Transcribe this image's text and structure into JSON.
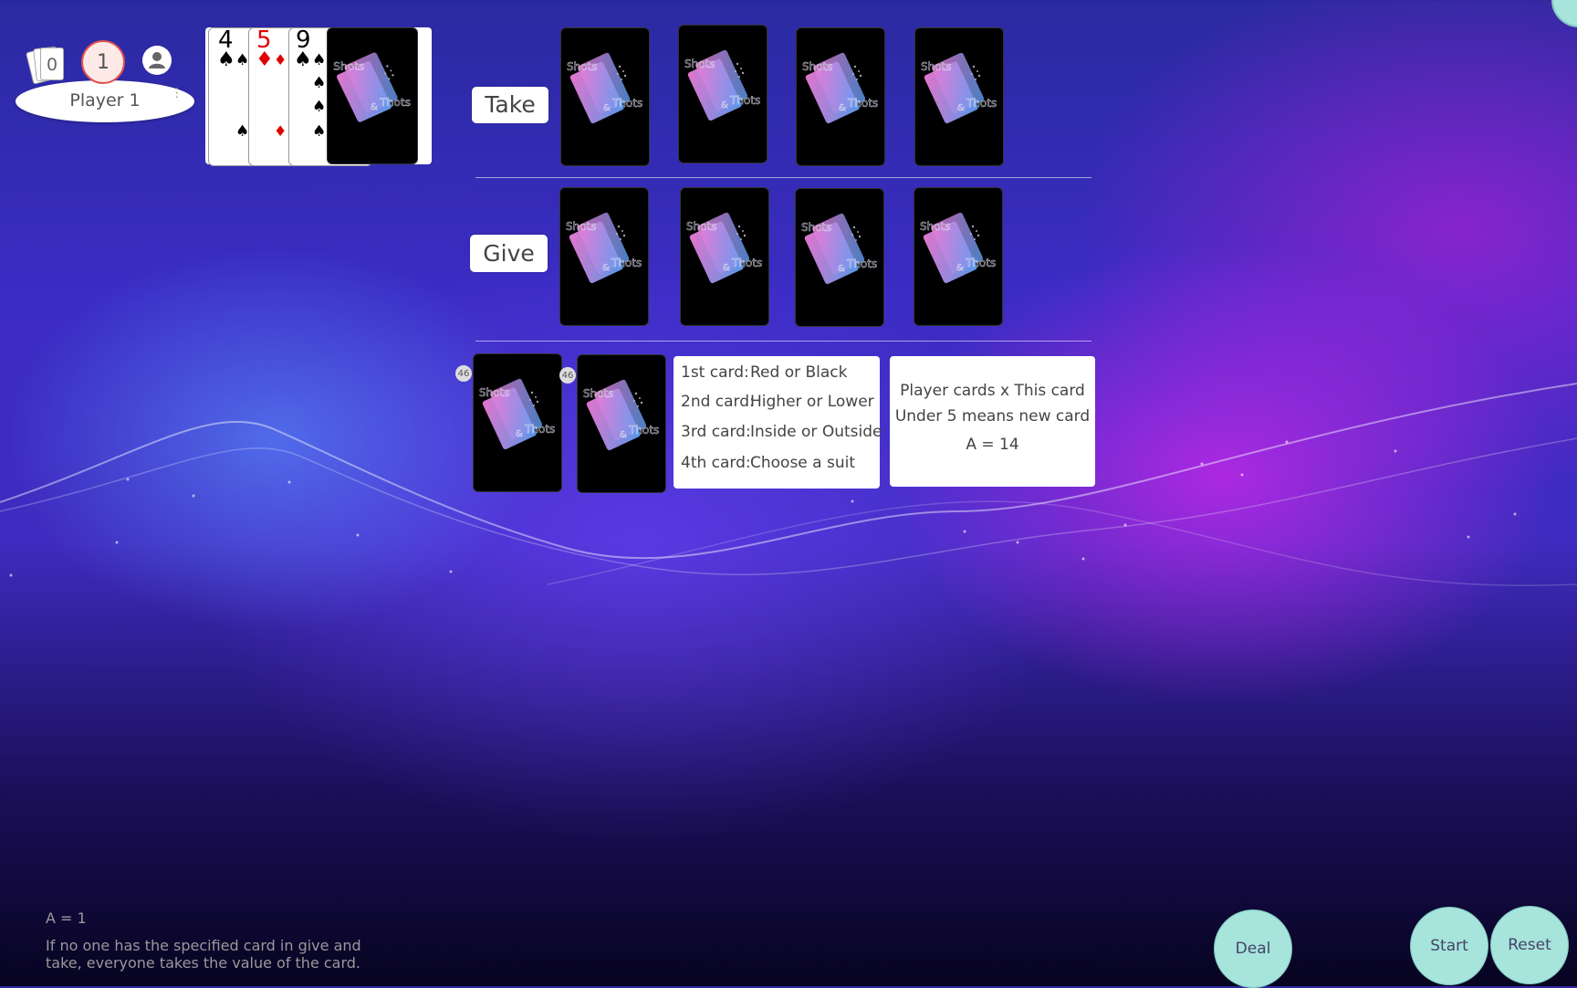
{
  "player": {
    "name": "Player 1",
    "card_count": "0",
    "score": "1"
  },
  "hand": [
    {
      "rank": "4",
      "suit": "♠",
      "color": "#000000"
    },
    {
      "rank": "5",
      "suit": "♦",
      "color": "#e00000"
    },
    {
      "rank": "9",
      "suit": "♠",
      "color": "#000000"
    }
  ],
  "rows": {
    "take_label": "Take",
    "give_label": "Give"
  },
  "card_back": {
    "line1": "Shots",
    "line2": "&",
    "line3": "Thots"
  },
  "deck": {
    "count_left": "46",
    "count_right": "46"
  },
  "rules": [
    {
      "label": "1st card:",
      "value": "Red or Black"
    },
    {
      "label": "2nd card:",
      "value": "Higher or Lower"
    },
    {
      "label": "3rd card:",
      "value": "Inside or Outside"
    },
    {
      "label": "4th card:",
      "value": "Choose a suit"
    }
  ],
  "scoring": {
    "line1": "Player cards x This card",
    "line2": "Under 5 means new card",
    "line3": "A = 14"
  },
  "footer": {
    "ace_note": "A = 1",
    "note_line1": "If no one has the specified card in give and",
    "note_line2": "take, everyone takes the value of the card."
  },
  "buttons": {
    "deal": "Deal",
    "start": "Start",
    "reset": "Reset"
  },
  "colors": {
    "accent_button": "#a6e4dc",
    "score_ring": "#e05050"
  }
}
